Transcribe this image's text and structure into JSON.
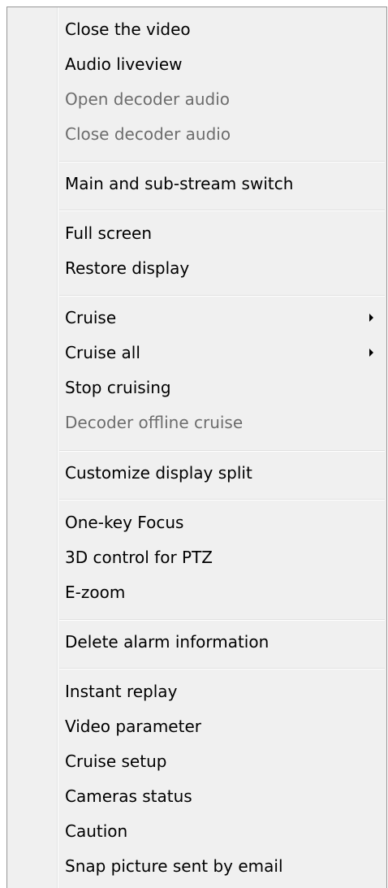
{
  "menu": {
    "items": [
      {
        "label": "Close the video",
        "disabled": false,
        "submenu": false
      },
      {
        "label": "Audio liveview",
        "disabled": false,
        "submenu": false
      },
      {
        "label": "Open decoder audio",
        "disabled": true,
        "submenu": false
      },
      {
        "label": "Close decoder audio",
        "disabled": true,
        "submenu": false
      },
      {
        "label": "Main and sub-stream switch",
        "disabled": false,
        "submenu": false
      },
      {
        "label": "Full screen",
        "disabled": false,
        "submenu": false
      },
      {
        "label": "Restore display",
        "disabled": false,
        "submenu": false
      },
      {
        "label": "Cruise",
        "disabled": false,
        "submenu": true
      },
      {
        "label": "Cruise all",
        "disabled": false,
        "submenu": true
      },
      {
        "label": "Stop cruising",
        "disabled": false,
        "submenu": false
      },
      {
        "label": "Decoder offline cruise",
        "disabled": true,
        "submenu": false
      },
      {
        "label": "Customize display split",
        "disabled": false,
        "submenu": false
      },
      {
        "label": "One-key Focus",
        "disabled": false,
        "submenu": false
      },
      {
        "label": "3D control for PTZ",
        "disabled": false,
        "submenu": false
      },
      {
        "label": "E-zoom",
        "disabled": false,
        "submenu": false
      },
      {
        "label": "Delete alarm information",
        "disabled": false,
        "submenu": false
      },
      {
        "label": "Instant replay",
        "disabled": false,
        "submenu": false
      },
      {
        "label": "Video parameter",
        "disabled": false,
        "submenu": false
      },
      {
        "label": "Cruise setup",
        "disabled": false,
        "submenu": false
      },
      {
        "label": "Cameras status",
        "disabled": false,
        "submenu": false
      },
      {
        "label": "Caution",
        "disabled": false,
        "submenu": false
      },
      {
        "label": "Snap picture sent by email",
        "disabled": false,
        "submenu": false
      }
    ],
    "icons": {
      "submenu_arrow": "chevron-right-icon"
    },
    "colors": {
      "background": "#f0f0f0",
      "text": "#000000",
      "disabled_text": "#6d6d6d",
      "border": "#979797"
    }
  }
}
